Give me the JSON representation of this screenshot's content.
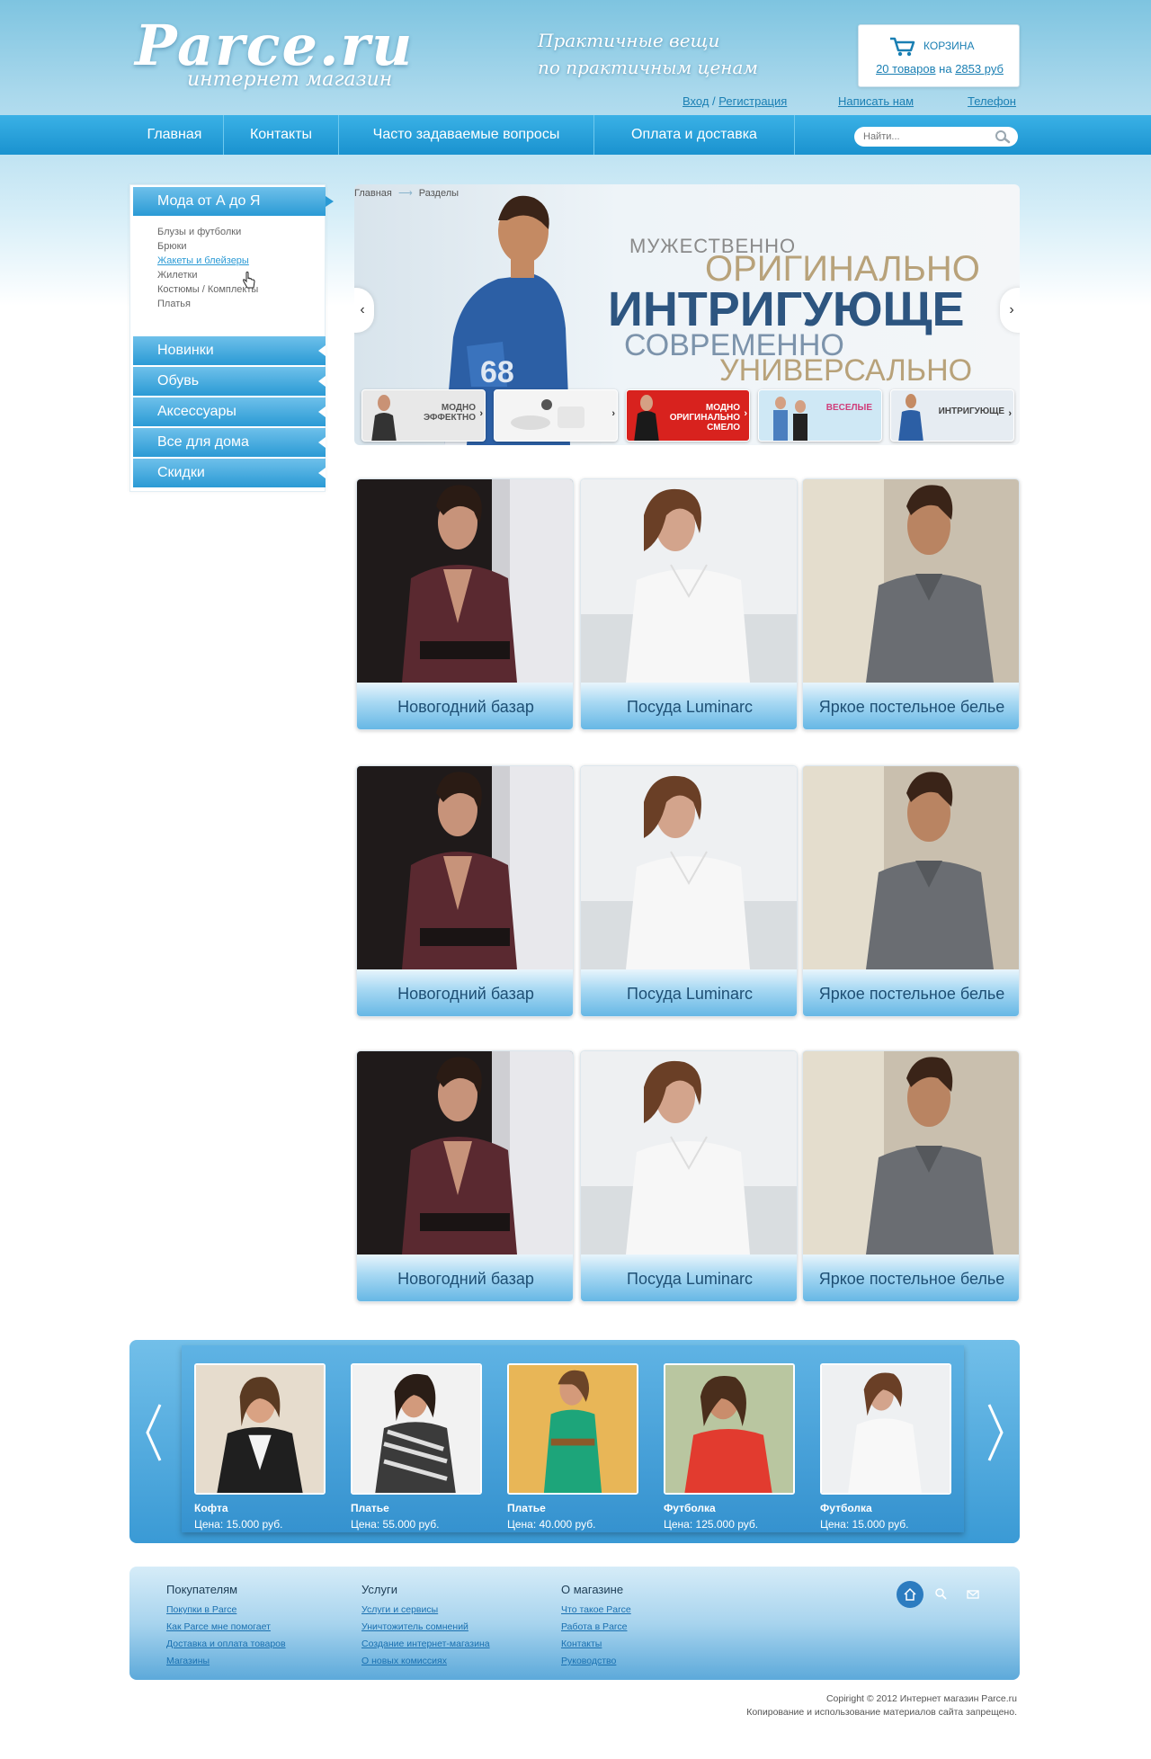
{
  "header": {
    "logo": "Parce.ru",
    "logo_sub": "интернет магазин",
    "slogan_line1": "Практичные вещи",
    "slogan_line2": "по практичным ценам",
    "cart": {
      "title": "КОРЗИНА",
      "count": "20 товаров",
      "on": "на",
      "sum": "2853 руб"
    },
    "links": {
      "login": "Вход",
      "sep": "/",
      "register": "Регистрация",
      "write": "Написать нам",
      "phone": "Телефон"
    }
  },
  "nav": {
    "items": [
      "Главная",
      "Контакты",
      "Часто задаваемые вопросы",
      "Оплата и доставка"
    ],
    "search_placeholder": "Найти..."
  },
  "sidebar": {
    "head": "Мода от А до Я",
    "sub_items": [
      "Блузы и футболки",
      "Брюки",
      "Жакеты и блейзеры",
      "Жилетки",
      "Костюмы / Комплекты",
      "Платья"
    ],
    "sections": [
      "Новинки",
      "Обувь",
      "Аксессуары",
      "Все для дома",
      "Скидки"
    ]
  },
  "breadcrumb": {
    "home": "Главная",
    "arrow": "⟶",
    "current": "Разделы"
  },
  "hero": {
    "w1": "МУЖЕСТВЕННО",
    "w2": "ОРИГИНАЛЬНО",
    "w3": "ИНТРИГУЮЩЕ",
    "w4": "СОВРЕМЕННО",
    "w5": "УНИВЕРСАЛЬНО",
    "prev": "‹",
    "next": "›",
    "thumbs": [
      {
        "text": "МОДНО\nЭФФЕКТНО",
        "color": "#e8e8e8"
      },
      {
        "text": "",
        "color": "#f2f2f2"
      },
      {
        "text": "МОДНО\nОРИГИНАЛЬНО\nСМЕЛО",
        "color": "#d8221e"
      },
      {
        "text": "ВЕСЕЛЫЕ",
        "color": "#cfe8f5"
      },
      {
        "text": "ИНТРИГУЮЩЕ",
        "color": "#e6ecf2"
      }
    ]
  },
  "tiles": {
    "captions": [
      "Новогодний базар",
      "Посуда Luminarc",
      "Яркое постельное белье"
    ]
  },
  "carousel": {
    "items": [
      {
        "name": "Кофта",
        "price": "Цена: 15.000 руб."
      },
      {
        "name": "Платье",
        "price": "Цена: 55.000 руб."
      },
      {
        "name": "Платье",
        "price": "Цена: 40.000 руб."
      },
      {
        "name": "Футболка",
        "price": "Цена: 125.000 руб."
      },
      {
        "name": "Футболка",
        "price": "Цена: 15.000 руб."
      }
    ]
  },
  "footer": {
    "col1": {
      "title": "Покупателям",
      "links": [
        "Покупки в Parce",
        "Как Parce мне помогает",
        "Доставка и оплата товаров",
        "Магазины"
      ]
    },
    "col2": {
      "title": "Услуги",
      "links": [
        "Услуги и сервисы",
        "Уничтожитель сомнений",
        "Создание интернет-магазина",
        "О новых комиссиях"
      ]
    },
    "col3": {
      "title": "О магазине",
      "links": [
        "Что такое Parce",
        "Работа в Parce",
        "Контакты",
        "Руководство"
      ]
    }
  },
  "copyright": {
    "line1": "Copiright © 2012 Интернет магазин  Parce.ru",
    "line2": "Копирование и использование материалов сайта запрещено."
  },
  "colors": {
    "accent": "#1a92cf",
    "link": "#1a7fb3"
  }
}
